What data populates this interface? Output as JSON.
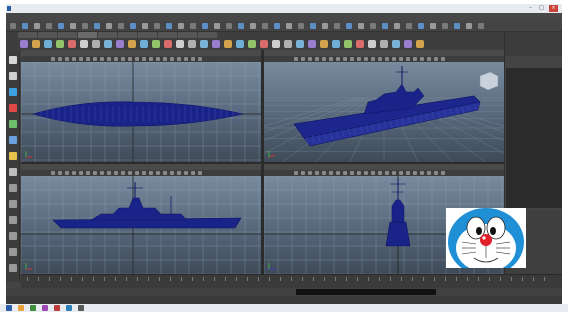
{
  "window": {
    "title": ""
  },
  "menubar": {
    "items": [
      "",
      "",
      "",
      "",
      "",
      "",
      "",
      "",
      "",
      "",
      "",
      "",
      "",
      "",
      "",
      "",
      "",
      "",
      "",
      "",
      "",
      "",
      ""
    ]
  },
  "shelf": {
    "tabs": [
      "",
      "",
      "",
      "",
      "",
      "",
      "",
      "",
      "",
      ""
    ]
  },
  "viewports": {
    "menu": [
      "",
      "",
      "",
      "",
      "",
      ""
    ],
    "top": {
      "label": ""
    },
    "persp": {
      "label": ""
    },
    "front": {
      "label": ""
    },
    "side": {
      "label": ""
    }
  },
  "right_panel": {
    "title": "",
    "tabs": [
      "",
      "",
      ""
    ]
  },
  "colors": {
    "accent": "#5a86c8",
    "viewport_top": "#7f93a7",
    "viewport_bottom": "#3f4a58",
    "wireframe": "#16207a",
    "ui_dark": "#444444"
  },
  "icons": [
    "maya-app-icon",
    "select-tool-icon",
    "move-tool-icon",
    "rotate-tool-icon",
    "scale-tool-icon",
    "axis-gizmo-icon",
    "view-cube-icon"
  ]
}
